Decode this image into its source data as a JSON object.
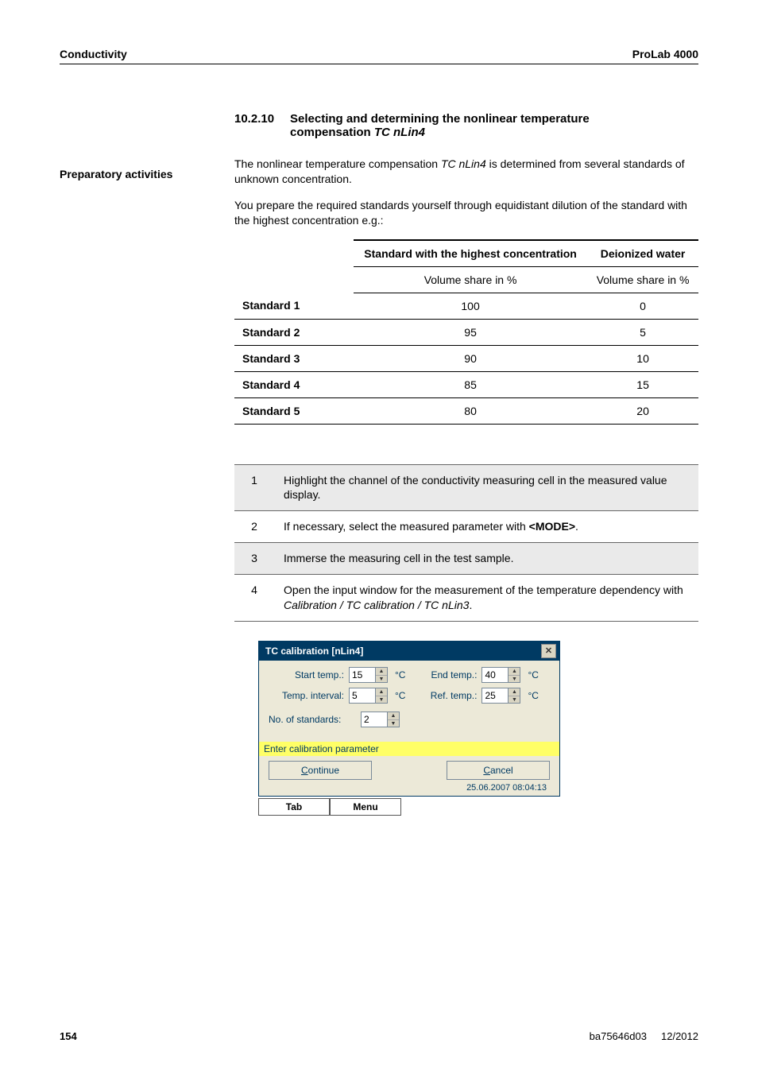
{
  "header": {
    "left": "Conductivity",
    "right": "ProLab 4000"
  },
  "section": {
    "number": "10.2.10",
    "title_line1": "Selecting and determining the nonlinear temperature",
    "title_line2": "compensation ",
    "title_em": "TC nLin4"
  },
  "side_label": "Preparatory activities",
  "intro": {
    "line1a": "The nonlinear temperature compensation ",
    "line1em": "TC nLin4",
    "line1b": " is determined from several standards of unknown concentration.",
    "line2": "You prepare the required standards yourself through equidistant dilution of the standard with the highest concentration e.g.:"
  },
  "std_table": {
    "head1": "Standard with the highest concentration",
    "head2": "Deionized water",
    "sub": "Volume share in %",
    "rows": [
      {
        "label": "Standard 1",
        "a": "100",
        "b": "0"
      },
      {
        "label": "Standard 2",
        "a": "95",
        "b": "5"
      },
      {
        "label": "Standard 3",
        "a": "90",
        "b": "10"
      },
      {
        "label": "Standard 4",
        "a": "85",
        "b": "15"
      },
      {
        "label": "Standard 5",
        "a": "80",
        "b": "20"
      }
    ]
  },
  "steps": [
    {
      "n": "1",
      "shade": true,
      "text": "Highlight the channel of the conductivity measuring cell in the measured value display."
    },
    {
      "n": "2",
      "shade": false,
      "pre": "If necessary, select the measured parameter with ",
      "bold": "<MODE>",
      "post": "."
    },
    {
      "n": "3",
      "shade": true,
      "text": "Immerse the measuring cell in the test sample."
    },
    {
      "n": "4",
      "shade": false,
      "pre": "Open the input window for the measurement of the temperature dependency with ",
      "em": "Calibration / TC calibration / TC nLin3",
      "post": "."
    }
  ],
  "dialog": {
    "title": "TC calibration [nLin4]",
    "start_temp_label": "Start temp.:",
    "start_temp_val": "15",
    "end_temp_label": "End temp.:",
    "end_temp_val": "40",
    "temp_interval_label": "Temp. interval:",
    "temp_interval_val": "5",
    "ref_temp_label": "Ref. temp.:",
    "ref_temp_val": "25",
    "unit": "°C",
    "no_std_label": "No. of standards:",
    "no_std_val": "2",
    "status": "Enter calibration parameter",
    "continue_u": "C",
    "continue_rest": "ontinue",
    "cancel_u": "C",
    "cancel_rest": "ancel",
    "timestamp": "25.06.2007 08:04:13",
    "tab": "Tab",
    "menu": "Menu"
  },
  "footer": {
    "page": "154",
    "doc": "ba75646d03",
    "date": "12/2012"
  }
}
